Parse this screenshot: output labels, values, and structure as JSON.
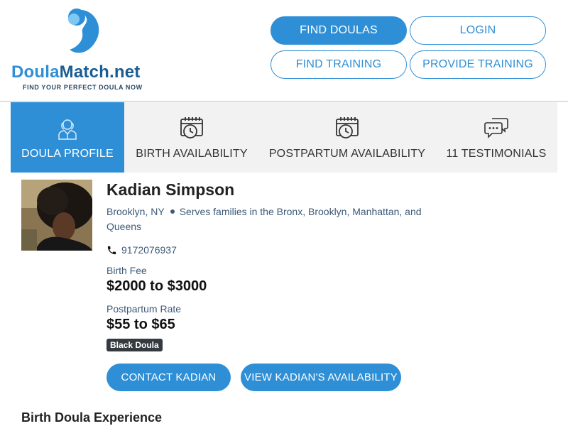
{
  "header": {
    "logo": {
      "word_part1": "Doula",
      "word_part2": "Match.net",
      "tagline": "FIND YOUR PERFECT DOULA NOW",
      "icon": "dm-logo-icon"
    },
    "nav": {
      "find_doulas": "FIND DOULAS",
      "login": "LOGIN",
      "find_training": "FIND TRAINING",
      "provide_training": "PROVIDE TRAINING"
    }
  },
  "tabs": [
    {
      "label": "DOULA PROFILE",
      "icon": "doula-person-icon",
      "active": true
    },
    {
      "label": "BIRTH AVAILABILITY",
      "icon": "calendar-clock-icon",
      "active": false
    },
    {
      "label": "POSTPARTUM AVAILABILITY",
      "icon": "calendar-clock-icon",
      "active": false
    },
    {
      "label": "11 TESTIMONIALS",
      "icon": "chat-bubbles-icon",
      "active": false
    }
  ],
  "profile": {
    "name": "Kadian Simpson",
    "city": "Brooklyn, NY",
    "serves": "Serves families in the Bronx, Brooklyn, Manhattan, and Queens",
    "phone": "9172076937",
    "birth_fee_label": "Birth Fee",
    "birth_fee_value": "$2000 to $3000",
    "pp_rate_label": "Postpartum Rate",
    "pp_rate_value": "$55 to $65",
    "badge": "Black Doula",
    "contact_button": "CONTACT KADIAN",
    "availability_button": "VIEW KADIAN'S AVAILABILITY"
  },
  "sections": {
    "experience_title": "Birth Doula Experience"
  },
  "colors": {
    "brand_blue": "#2e8fd6",
    "brand_dark": "#1a5d93",
    "tab_bg": "#f2f2f2",
    "badge_bg": "#343a40"
  }
}
